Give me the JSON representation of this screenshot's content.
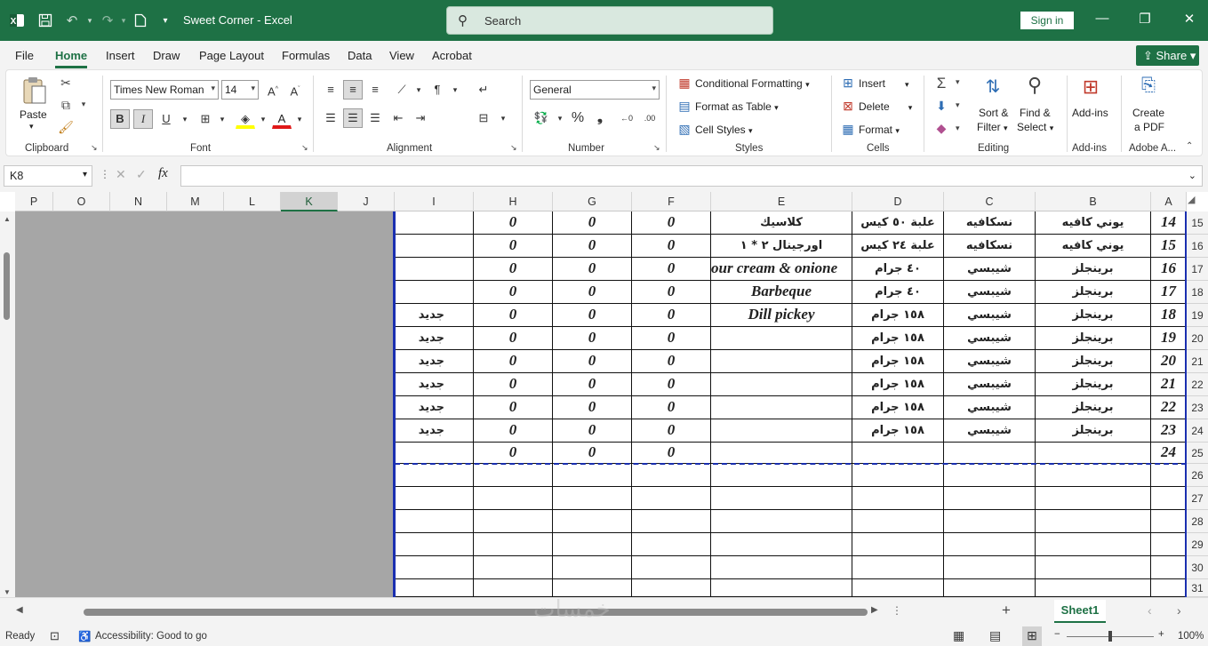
{
  "window": {
    "title": "Sweet Corner  -  Excel",
    "search_placeholder": "Search",
    "signin": "Sign in"
  },
  "menu": {
    "tabs": [
      "File",
      "Home",
      "Insert",
      "Draw",
      "Page Layout",
      "Formulas",
      "Data",
      "View",
      "Acrobat"
    ],
    "active": "Home",
    "share": "Share"
  },
  "ribbon": {
    "clipboard": {
      "paste": "Paste",
      "label": "Clipboard"
    },
    "font": {
      "name": "Times New Roman",
      "size": "14",
      "bold": "B",
      "italic": "I",
      "underline": "U",
      "label": "Font"
    },
    "alignment": {
      "label": "Alignment"
    },
    "number": {
      "format": "General",
      "label": "Number"
    },
    "styles": {
      "conditional": "Conditional Formatting",
      "table": "Format as Table",
      "cellstyles": "Cell Styles",
      "label": "Styles"
    },
    "cells": {
      "insert": "Insert",
      "delete": "Delete",
      "format": "Format",
      "label": "Cells"
    },
    "editing": {
      "sort": "Sort &",
      "filter": "Filter",
      "find": "Find &",
      "select": "Select",
      "label": "Editing"
    },
    "addins": {
      "addins": "Add-ins",
      "label": "Add-ins"
    },
    "adobe": {
      "create": "Create",
      "pdf": "a PDF",
      "label": "Adobe A..."
    }
  },
  "formula_bar": {
    "name_box": "K8",
    "fx": "fx",
    "content": ""
  },
  "columns": [
    "P",
    "O",
    "N",
    "M",
    "L",
    "K",
    "J",
    "I",
    "H",
    "G",
    "F",
    "E",
    "D",
    "C",
    "B",
    "A"
  ],
  "selected_column": "K",
  "row_numbers": [
    "15",
    "16",
    "17",
    "18",
    "19",
    "20",
    "21",
    "22",
    "23",
    "24",
    "25",
    "26",
    "27",
    "28",
    "29",
    "30",
    "31"
  ],
  "rows": [
    {
      "A": "14",
      "B": "يوني كافيه",
      "C": "نسكافيه",
      "D": "علبة ٥٠ كيس",
      "E": "كلاسيك",
      "F": "0",
      "G": "0",
      "H": "0",
      "I": ""
    },
    {
      "A": "15",
      "B": "يوني كافيه",
      "C": "نسكافيه",
      "D": "علبة ٢٤ كيس",
      "E": "اورجينال ٢ * ١",
      "F": "0",
      "G": "0",
      "H": "0",
      "I": ""
    },
    {
      "A": "16",
      "B": "برينجلز",
      "C": "شيبسي",
      "D": "٤٠ جرام",
      "E": "our cream & onione",
      "F": "0",
      "G": "0",
      "H": "0",
      "I": ""
    },
    {
      "A": "17",
      "B": "برينجلز",
      "C": "شيبسي",
      "D": "٤٠ جرام",
      "E": "Barbeque",
      "F": "0",
      "G": "0",
      "H": "0",
      "I": ""
    },
    {
      "A": "18",
      "B": "برينجلز",
      "C": "شيبسي",
      "D": "١٥٨ جرام",
      "E": "Dill pickey",
      "F": "0",
      "G": "0",
      "H": "0",
      "I": "جديد"
    },
    {
      "A": "19",
      "B": "برينجلز",
      "C": "شيبسي",
      "D": "١٥٨ جرام",
      "E": "",
      "F": "0",
      "G": "0",
      "H": "0",
      "I": "جديد"
    },
    {
      "A": "20",
      "B": "برينجلز",
      "C": "شيبسي",
      "D": "١٥٨ جرام",
      "E": "",
      "F": "0",
      "G": "0",
      "H": "0",
      "I": "جديد"
    },
    {
      "A": "21",
      "B": "برينجلز",
      "C": "شيبسي",
      "D": "١٥٨ جرام",
      "E": "",
      "F": "0",
      "G": "0",
      "H": "0",
      "I": "جديد"
    },
    {
      "A": "22",
      "B": "برينجلز",
      "C": "شيبسي",
      "D": "١٥٨ جرام",
      "E": "",
      "F": "0",
      "G": "0",
      "H": "0",
      "I": "جديد"
    },
    {
      "A": "23",
      "B": "برينجلز",
      "C": "شيبسي",
      "D": "١٥٨ جرام",
      "E": "",
      "F": "0",
      "G": "0",
      "H": "0",
      "I": "جديد"
    },
    {
      "A": "24",
      "B": "",
      "C": "",
      "D": "",
      "E": "",
      "F": "0",
      "G": "0",
      "H": "0",
      "I": ""
    }
  ],
  "sheet_tab": "Sheet1",
  "watermark": "خمسات",
  "status": {
    "ready": "Ready",
    "accessibility": "Accessibility: Good to go",
    "zoom": "100%"
  },
  "colors": {
    "accent": "#1e7145",
    "page_break": "#1a2fb0"
  }
}
